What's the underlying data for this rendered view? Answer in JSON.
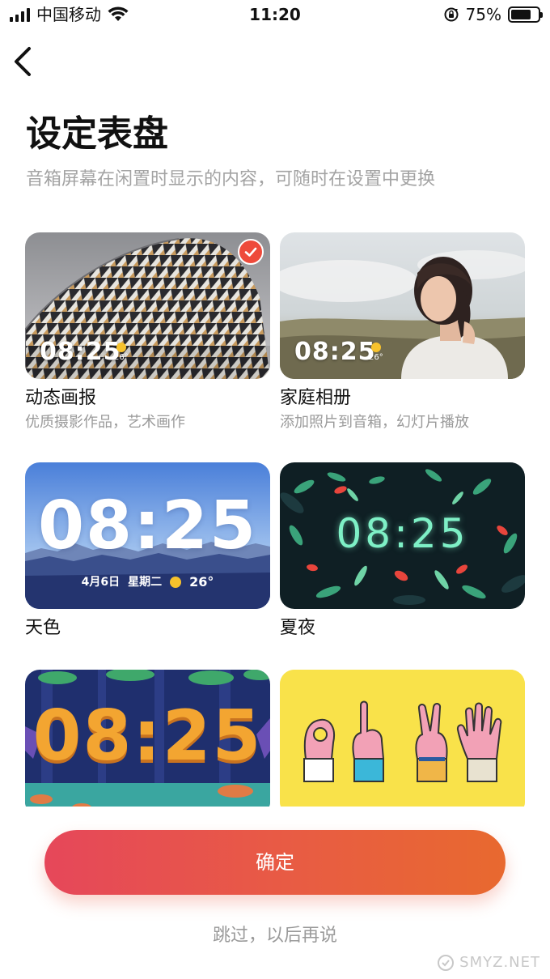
{
  "status_bar": {
    "carrier": "中国移动",
    "time": "11:20",
    "battery": "75%",
    "battery_level": 0.75
  },
  "header": {
    "back_icon": "chevron-left-icon",
    "title": "设定表盘",
    "subtitle": "音箱屏幕在闲置时显示的内容，可随时在设置中更换"
  },
  "faces": [
    {
      "name": "动态画报",
      "desc": "优质摄影作品，艺术画作",
      "time": "08:25",
      "temp": "26°",
      "selected": true
    },
    {
      "name": "家庭相册",
      "desc": "添加照片到音箱，幻灯片播放",
      "time": "08:25",
      "temp": "26°",
      "selected": false
    },
    {
      "name": "天色",
      "time": "08:25",
      "date": "4月6日",
      "weekday": "星期二",
      "temp": "26°"
    },
    {
      "name": "夏夜",
      "time": "08:25"
    },
    {
      "name": "",
      "time": "08:25"
    },
    {
      "name": ""
    }
  ],
  "actions": {
    "confirm": "确定",
    "skip": "跳过，以后再说"
  },
  "watermark": "SMYZ.NET",
  "colors": {
    "accent_start": "#e6475a",
    "accent_end": "#e8692f",
    "check": "#ee4a3b",
    "sun": "#f7c22c"
  }
}
